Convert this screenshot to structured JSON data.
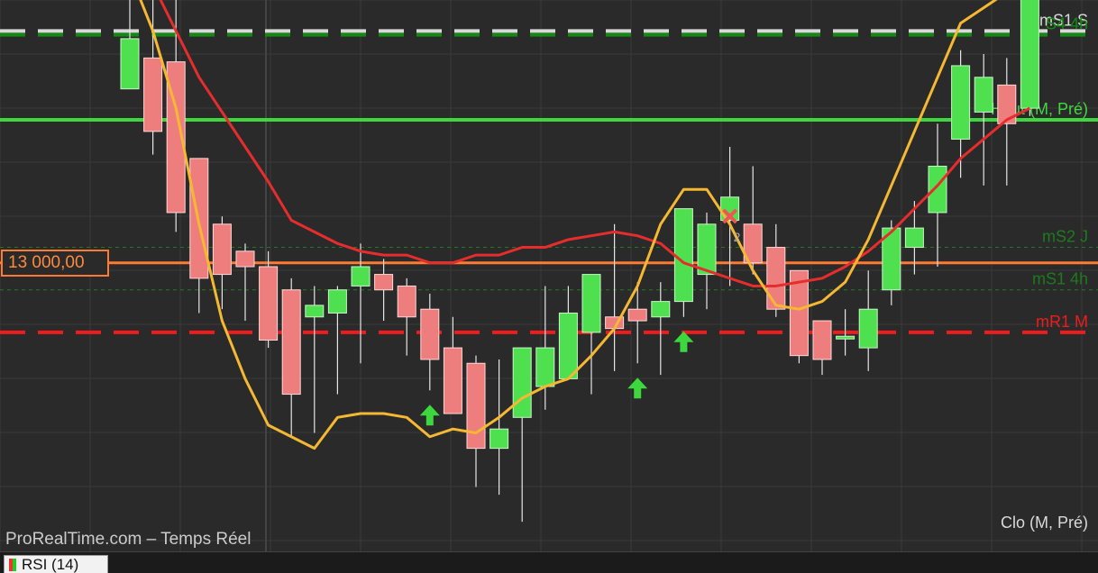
{
  "chart_data": {
    "type": "candlestick",
    "title": "",
    "price_range": [
      12300,
      13680
    ],
    "candles": [
      {
        "o": 13450,
        "h": 13700,
        "l": 13640,
        "c": 13580
      },
      {
        "o": 13530,
        "h": 13700,
        "l": 13280,
        "c": 13340
      },
      {
        "o": 13520,
        "h": 13700,
        "l": 13080,
        "c": 13130
      },
      {
        "o": 13270,
        "h": 13110,
        "l": 12870,
        "c": 12960
      },
      {
        "o": 13100,
        "h": 13120,
        "l": 12880,
        "c": 12970
      },
      {
        "o": 13030,
        "h": 13050,
        "l": 12850,
        "c": 12990
      },
      {
        "o": 12990,
        "h": 13030,
        "l": 12780,
        "c": 12800
      },
      {
        "o": 12930,
        "h": 12960,
        "l": 12550,
        "c": 12660
      },
      {
        "o": 12860,
        "h": 12940,
        "l": 12560,
        "c": 12890
      },
      {
        "o": 12870,
        "h": 12940,
        "l": 12660,
        "c": 12930
      },
      {
        "o": 12940,
        "h": 13050,
        "l": 12740,
        "c": 12990
      },
      {
        "o": 12970,
        "h": 13010,
        "l": 12850,
        "c": 12930
      },
      {
        "o": 12940,
        "h": 12960,
        "l": 12760,
        "c": 12860
      },
      {
        "o": 12880,
        "h": 12920,
        "l": 12670,
        "c": 12750
      },
      {
        "o": 12780,
        "h": 12860,
        "l": 12620,
        "c": 12610
      },
      {
        "o": 12740,
        "h": 12760,
        "l": 12420,
        "c": 12520
      },
      {
        "o": 12520,
        "h": 12750,
        "l": 12400,
        "c": 12570
      },
      {
        "o": 12600,
        "h": 12770,
        "l": 12330,
        "c": 12780
      },
      {
        "o": 12680,
        "h": 12940,
        "l": 12620,
        "c": 12780
      },
      {
        "o": 12700,
        "h": 12940,
        "l": 12700,
        "c": 12870
      },
      {
        "o": 12820,
        "h": 12940,
        "l": 12660,
        "c": 12970
      },
      {
        "o": 12860,
        "h": 13100,
        "l": 12720,
        "c": 12830
      },
      {
        "o": 12880,
        "h": 12950,
        "l": 12740,
        "c": 12850
      },
      {
        "o": 12860,
        "h": 12950,
        "l": 12710,
        "c": 12900
      },
      {
        "o": 12900,
        "h": 13060,
        "l": 12860,
        "c": 13140
      },
      {
        "o": 12970,
        "h": 13130,
        "l": 12880,
        "c": 13100
      },
      {
        "o": 13110,
        "h": 13300,
        "l": 12940,
        "c": 13170
      },
      {
        "o": 13100,
        "h": 13250,
        "l": 12970,
        "c": 13000
      },
      {
        "o": 13040,
        "h": 13100,
        "l": 12860,
        "c": 12880
      },
      {
        "o": 12980,
        "h": 12920,
        "l": 12740,
        "c": 12760
      },
      {
        "o": 12850,
        "h": 12850,
        "l": 12710,
        "c": 12750
      },
      {
        "o": 12810,
        "h": 12880,
        "l": 12760,
        "c": 12810
      },
      {
        "o": 12780,
        "h": 12980,
        "l": 12720,
        "c": 12880
      },
      {
        "o": 12930,
        "h": 13110,
        "l": 12890,
        "c": 13090
      },
      {
        "o": 13040,
        "h": 13160,
        "l": 12970,
        "c": 13090
      },
      {
        "o": 13130,
        "h": 13360,
        "l": 12990,
        "c": 13250
      },
      {
        "o": 13320,
        "h": 13550,
        "l": 13220,
        "c": 13510
      },
      {
        "o": 13390,
        "h": 13540,
        "l": 13200,
        "c": 13480
      },
      {
        "o": 13460,
        "h": 13530,
        "l": 13200,
        "c": 13360
      },
      {
        "o": 13400,
        "h": 13690,
        "l": 13380,
        "c": 13710
      }
    ],
    "levels": [
      {
        "name": "mS1 S",
        "value": 13600,
        "style": "dashed",
        "color": "#d9d9d9"
      },
      {
        "name": "S4 4h",
        "value": 13590,
        "style": "dashed",
        "color": "#138a13"
      },
      {
        "name": "Haut (M, Pré)",
        "value": 13370,
        "style": "solid",
        "color": "#3ed83e"
      },
      {
        "name": "mS2 J",
        "value": 13040,
        "style": "dotted",
        "color": "#1e7a1e"
      },
      {
        "name": "mS1 4h",
        "value": 12930,
        "style": "dotted",
        "color": "#1e7a1e"
      },
      {
        "name": "mR1 M",
        "value": 12820,
        "style": "dashed",
        "color": "#ee1c1c"
      },
      {
        "name": "Clo (M, Pré)",
        "value": 12300,
        "style": "none",
        "color": "#d9d9d9"
      }
    ],
    "horizontal_line": {
      "value": 13000,
      "label": "13 000,00",
      "color": "#ff7a33"
    },
    "series": [
      {
        "type": "moving_average",
        "color": "#e62d2d",
        "values": [
          13800,
          13720,
          13600,
          13480,
          13390,
          13300,
          13210,
          13110,
          13080,
          13050,
          13030,
          13020,
          13020,
          13000,
          13000,
          13020,
          13020,
          13040,
          13040,
          13060,
          13070,
          13080,
          13070,
          13050,
          13000,
          12980,
          12960,
          12940,
          12940,
          12950,
          12960,
          12990,
          13030,
          13080,
          13140,
          13200,
          13270,
          13320,
          13370,
          13400
        ]
      },
      {
        "type": "moving_average",
        "color": "#f5b833",
        "values": [
          13750,
          13600,
          13400,
          13100,
          12850,
          12700,
          12580,
          12550,
          12520,
          12600,
          12610,
          12610,
          12600,
          12550,
          12570,
          12560,
          12600,
          12650,
          12680,
          12700,
          12760,
          12830,
          12940,
          13100,
          13190,
          13190,
          13100,
          12980,
          12890,
          12880,
          12900,
          12950,
          13060,
          13200,
          13340,
          13480,
          13620,
          13660,
          13700,
          13720
        ]
      }
    ],
    "annotations": [
      {
        "type": "arrow-up",
        "color": "#3dd83d"
      },
      {
        "type": "arrow-up",
        "color": "#3dd83d"
      },
      {
        "type": "arrow-up",
        "color": "#3dd83d"
      },
      {
        "type": "cross",
        "color": "#f05454",
        "label": "2"
      }
    ]
  },
  "watermark": "ProRealTime.com – Temps Réel",
  "price_tag": "13 000,00",
  "bottom_tab": "RSI (14)"
}
